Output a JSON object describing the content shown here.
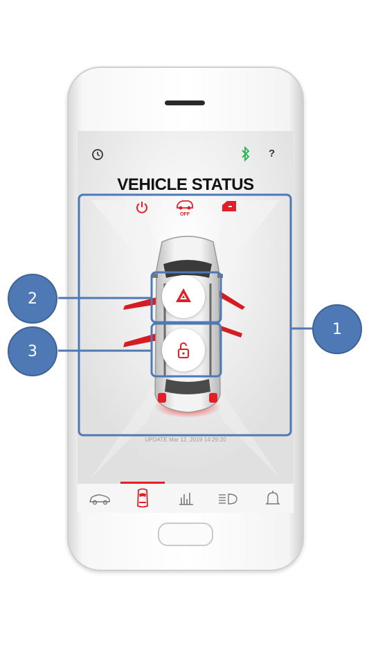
{
  "screen": {
    "title": "VEHICLE STATUS",
    "update_text": "UPDATE Mar 12, 2019 14:29:20",
    "help_label": "?"
  },
  "status_icons": [
    "power-icon",
    "engine-off-icon",
    "door-open-icon"
  ],
  "status_icon_labels": {
    "engine_off": "OFF"
  },
  "controls": {
    "hazard_button": "hazard-warning-icon",
    "lock_button": "unlock-icon"
  },
  "tabs": [
    {
      "name": "vehicle-tab",
      "icon": "car-side-icon",
      "active": false
    },
    {
      "name": "status-tab",
      "icon": "car-top-icon",
      "active": true
    },
    {
      "name": "stats-tab",
      "icon": "bar-chart-icon",
      "active": false
    },
    {
      "name": "lights-tab",
      "icon": "headlight-icon",
      "active": false
    },
    {
      "name": "notifications-tab",
      "icon": "bell-icon",
      "active": false
    }
  ],
  "callouts": [
    {
      "number": "1"
    },
    {
      "number": "2"
    },
    {
      "number": "3"
    }
  ],
  "colors": {
    "accent_red": "#e41e26",
    "callout_blue": "#4f79b4",
    "bluetooth_green": "#2fb55a"
  }
}
